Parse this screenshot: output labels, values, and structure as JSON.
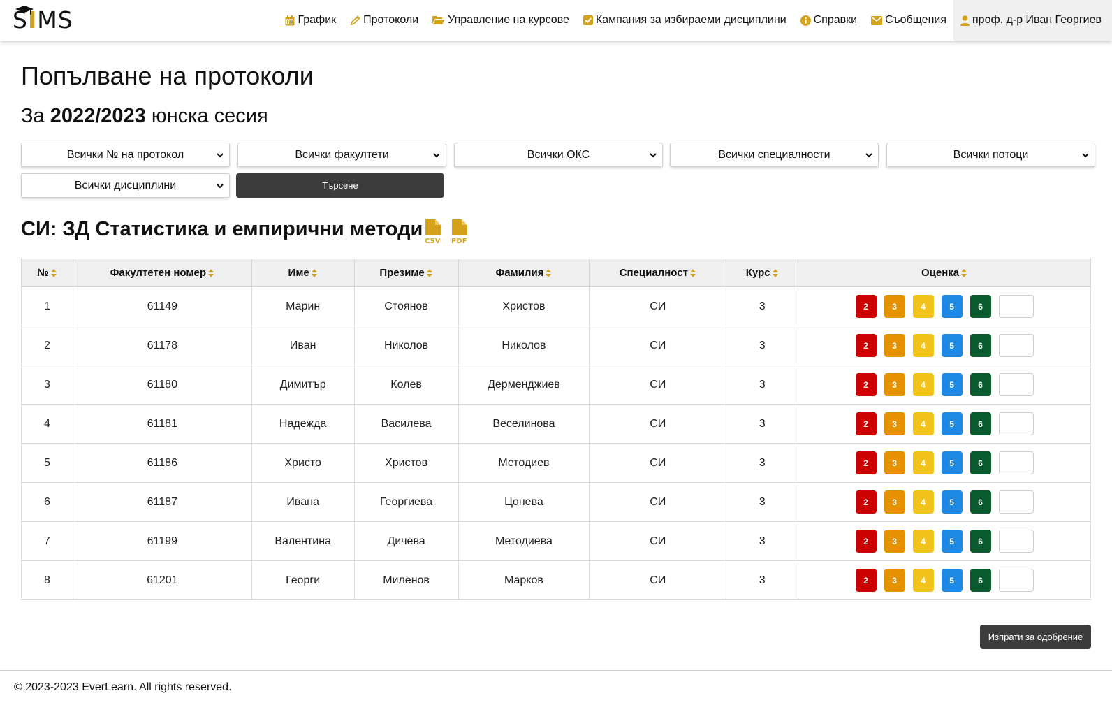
{
  "brand": {
    "logo_text_1": "S",
    "logo_text_2": "I",
    "logo_text_3": "MS"
  },
  "nav": [
    {
      "icon": "calendar-icon",
      "label": "График"
    },
    {
      "icon": "pencil-icon",
      "label": "Протоколи"
    },
    {
      "icon": "folder-open-icon",
      "label": "Управление на курсове"
    },
    {
      "icon": "check-square-icon",
      "label": "Кампания за избираеми дисциплини"
    },
    {
      "icon": "info-circle-icon",
      "label": "Справки"
    },
    {
      "icon": "envelope-icon",
      "label": "Съобщения"
    },
    {
      "icon": "user-icon",
      "label": "проф. д-р Иван Георгиев"
    }
  ],
  "page_title": "Попълване на протоколи",
  "subtitle": {
    "prefix": "За ",
    "bold": "2022/2023",
    "suffix": " юнска сесия"
  },
  "filters": {
    "protocol": "Всички № на протокол",
    "faculty": "Всички факултети",
    "oks": "Всички ОКС",
    "specialty": "Всички специалности",
    "stream": "Всички потоци",
    "discipline": "Всички дисциплини",
    "search_button": "Търсене"
  },
  "section_title": "СИ: ЗД Статистика и емпирични методи",
  "export": {
    "csv": "CSV",
    "pdf": "PDF"
  },
  "table": {
    "headers": [
      "№",
      "Факултетен номер",
      "Име",
      "Презиме",
      "Фамилия",
      "Специалност",
      "Курс",
      "Оценка"
    ],
    "grade_buttons": [
      "2",
      "3",
      "4",
      "5",
      "6"
    ],
    "rows": [
      {
        "no": "1",
        "fn": "61149",
        "first": "Марин",
        "middle": "Стоянов",
        "last": "Христов",
        "spec": "СИ",
        "course": "3"
      },
      {
        "no": "2",
        "fn": "61178",
        "first": "Иван",
        "middle": "Николов",
        "last": "Николов",
        "spec": "СИ",
        "course": "3"
      },
      {
        "no": "3",
        "fn": "61180",
        "first": "Димитър",
        "middle": "Колев",
        "last": "Дерменджиев",
        "spec": "СИ",
        "course": "3"
      },
      {
        "no": "4",
        "fn": "61181",
        "first": "Надежда",
        "middle": "Василева",
        "last": "Веселинова",
        "spec": "СИ",
        "course": "3"
      },
      {
        "no": "5",
        "fn": "61186",
        "first": "Христо",
        "middle": "Христов",
        "last": "Методиев",
        "spec": "СИ",
        "course": "3"
      },
      {
        "no": "6",
        "fn": "61187",
        "first": "Ивана",
        "middle": "Георгиева",
        "last": "Цонева",
        "spec": "СИ",
        "course": "3"
      },
      {
        "no": "7",
        "fn": "61199",
        "first": "Валентина",
        "middle": "Дичева",
        "last": "Методиева",
        "spec": "СИ",
        "course": "3"
      },
      {
        "no": "8",
        "fn": "61201",
        "first": "Георги",
        "middle": "Миленов",
        "last": "Марков",
        "spec": "СИ",
        "course": "3"
      }
    ]
  },
  "submit_button": "Изпрати за одобрение",
  "footer": "© 2023-2023 EverLearn. All rights reserved.",
  "colors": {
    "accent": "#d4a21a",
    "grade2": "#cc0000",
    "grade3": "#e69100",
    "grade4": "#f2c31a",
    "grade5": "#1e88e5",
    "grade6": "#0a5c2f",
    "dark_button": "#3c3c3c"
  }
}
